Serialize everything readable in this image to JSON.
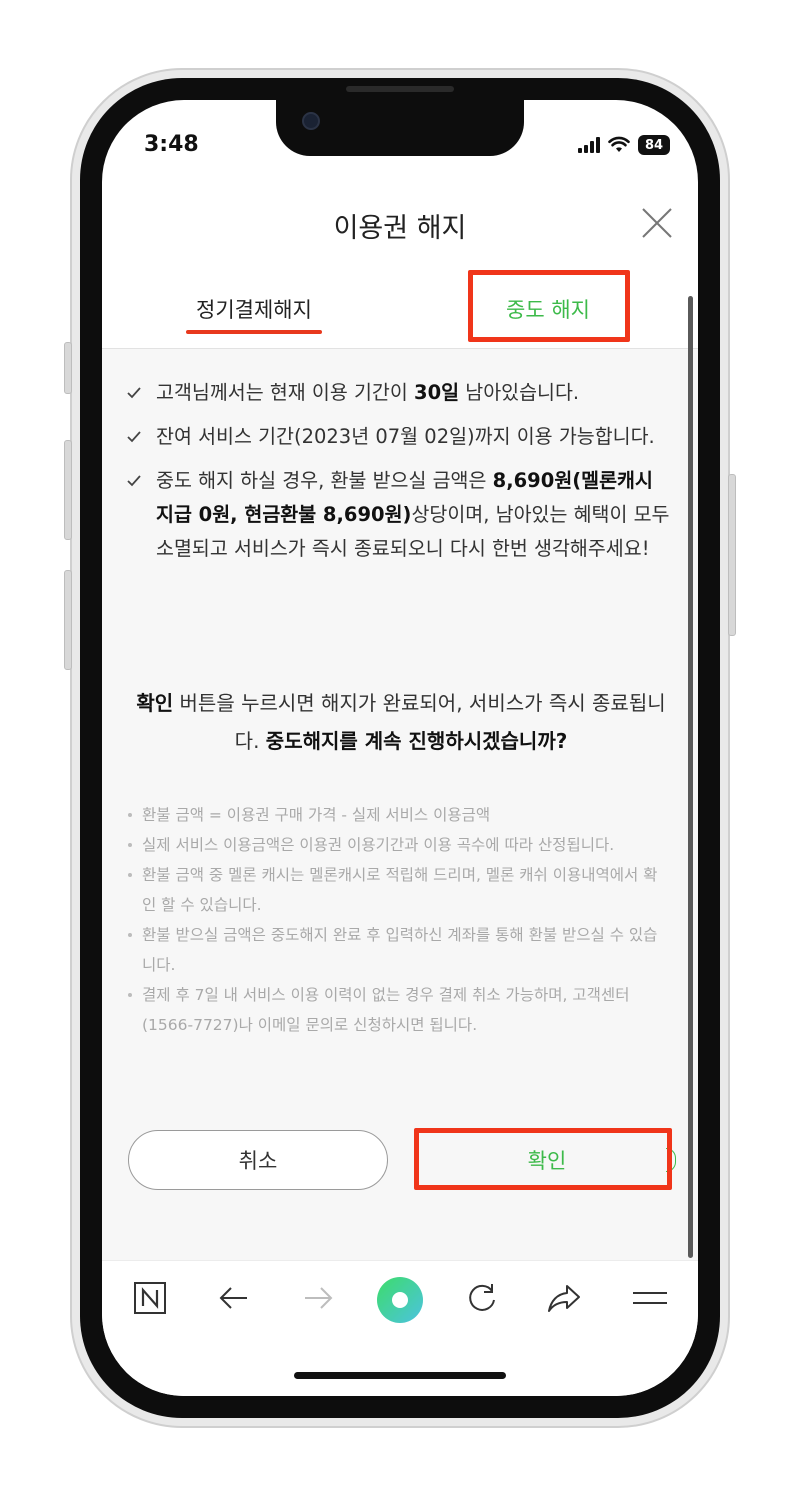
{
  "status_bar": {
    "time": "3:48",
    "battery": "84"
  },
  "header": {
    "title": "이용권 해지"
  },
  "tabs": [
    {
      "label": "정기결제해지"
    },
    {
      "label": "중도 해지"
    }
  ],
  "checklist": [
    {
      "pre": "고객님께서는 현재 이용 기간이 ",
      "bold": "30일",
      "post": " 남아있습니다."
    },
    {
      "pre": "잔여 서비스 기간(2023년 07월 02일)까지 이용 가능합니다.",
      "bold": "",
      "post": ""
    },
    {
      "pre": "중도 해지 하실 경우, 환불 받으실 금액은 ",
      "bold": "8,690원(멜론캐시 지급 0원, 현금환불 8,690원)",
      "post": "상당이며, 남아있는 혜택이 모두 소멸되고 서비스가 즉시 종료되오니 다시 한번 생각해주세요!"
    }
  ],
  "confirm_message": {
    "bold1": "확인",
    "text1": " 버튼을 누르시면 해지가 완료되어, 서비스가 즉시 종료됩니다. ",
    "bold2": "중도해지를 계속 진행하시겠습니까?"
  },
  "notes": [
    "환불 금액 = 이용권 구매 가격 - 실제 서비스 이용금액",
    "실제 서비스 이용금액은 이용권 이용기간과 이용 곡수에 따라 산정됩니다.",
    "환불 금액 중 멜론 캐시는 멜론캐시로 적립해 드리며, 멜론 캐쉬 이용내역에서 확인 할 수 있습니다.",
    "환불 받으실 금액은 중도해지 완료 후 입력하신 계좌를 통해 환불 받으실 수 있습니다.",
    "결제 후 7일 내 서비스 이용 이력이 없는 경우 결제 취소 가능하며, 고객센터(1566-7727)나 이메일 문의로 신청하시면 됩니다."
  ],
  "buttons": {
    "cancel": "취소",
    "confirm": "확인"
  },
  "browser_bar": {
    "icons": [
      "naver-n-icon",
      "back-arrow-icon",
      "forward-arrow-icon",
      "home-circle-icon",
      "reload-icon",
      "share-icon",
      "menu-icon"
    ],
    "logo_letter": "N"
  },
  "colors": {
    "accent_green": "#3dba4a",
    "annotation_red": "#f0351a"
  }
}
